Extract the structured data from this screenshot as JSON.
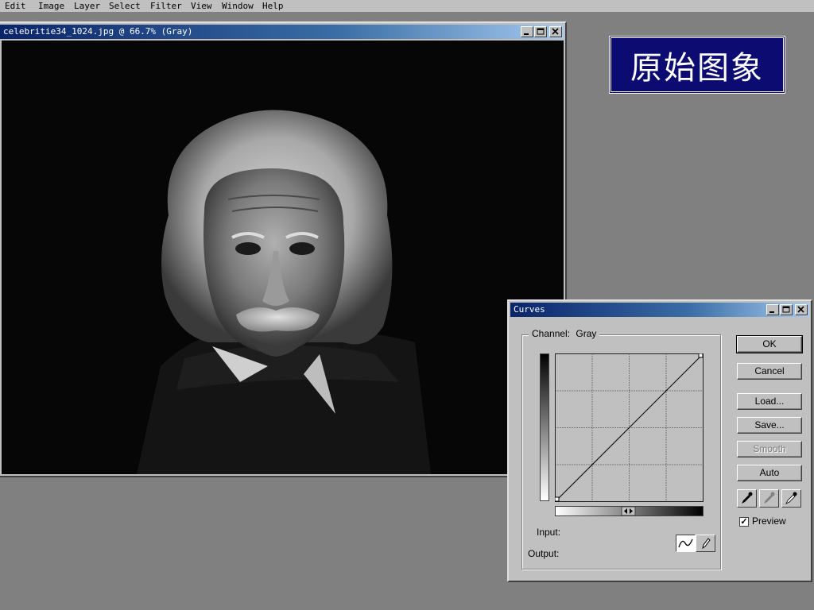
{
  "menu": {
    "items": [
      "Edit",
      "Image",
      "Layer",
      "Select",
      "Filter",
      "View",
      "Window",
      "Help"
    ]
  },
  "image_window": {
    "title": "celebritie34_1024.jpg @ 66.7% (Gray)",
    "zoom": "66.7%",
    "mode": "Gray"
  },
  "caption": {
    "text": "原始图象",
    "bg_color": "#0b0b72"
  },
  "curves_dialog": {
    "title": "Curves",
    "channel_label": "Channel:",
    "channel_value": "Gray",
    "buttons": {
      "ok": "OK",
      "cancel": "Cancel",
      "load": "Load...",
      "save": "Save...",
      "smooth": "Smooth",
      "auto": "Auto"
    },
    "preview_label": "Preview",
    "preview_checked": true,
    "input_label": "Input:",
    "output_label": "Output:",
    "curve": {
      "points": [
        [
          0,
          0
        ],
        [
          255,
          255
        ]
      ],
      "grid_divisions": 4
    },
    "eyedroppers": [
      "black-eyedropper-icon",
      "gray-eyedropper-icon",
      "white-eyedropper-icon"
    ],
    "smooth_disabled": true
  },
  "colors": {
    "desktop": "#808080",
    "titlebar_start": "#0a246a",
    "window_face": "#c0c0c0"
  }
}
